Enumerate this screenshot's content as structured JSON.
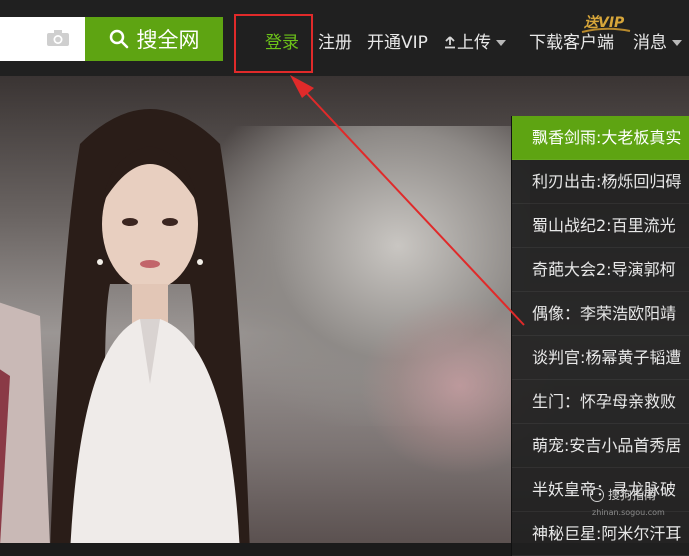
{
  "search": {
    "button_label": "搜全网",
    "placeholder": ""
  },
  "nav": {
    "login": "登录",
    "register": "注册",
    "vip": "开通VIP",
    "upload": "上传",
    "download": "下载客户端",
    "download_badge": "送VIP",
    "messages": "消息"
  },
  "list": [
    {
      "label": "飘香剑雨:大老板真实"
    },
    {
      "label": "利刃出击:杨烁回归碍"
    },
    {
      "label": "蜀山战纪2:百里流光"
    },
    {
      "label": "奇葩大会2:导演郭柯"
    },
    {
      "label": "偶像：李荣浩欧阳靖"
    },
    {
      "label": "谈判官:杨幂黄子韬遭"
    },
    {
      "label": "生门：怀孕母亲救败"
    },
    {
      "label": "萌宠:安吉小品首秀居"
    },
    {
      "label": "半妖皇帝：寻龙脉破"
    },
    {
      "label": "神秘巨星:阿米尔汗耳"
    }
  ],
  "watermark": {
    "text": "搜狗指南",
    "sub": "zhinan.sogou.com"
  },
  "colors": {
    "accent": "#5ea412",
    "highlight": "#e02a2a",
    "topbar": "#202020"
  }
}
